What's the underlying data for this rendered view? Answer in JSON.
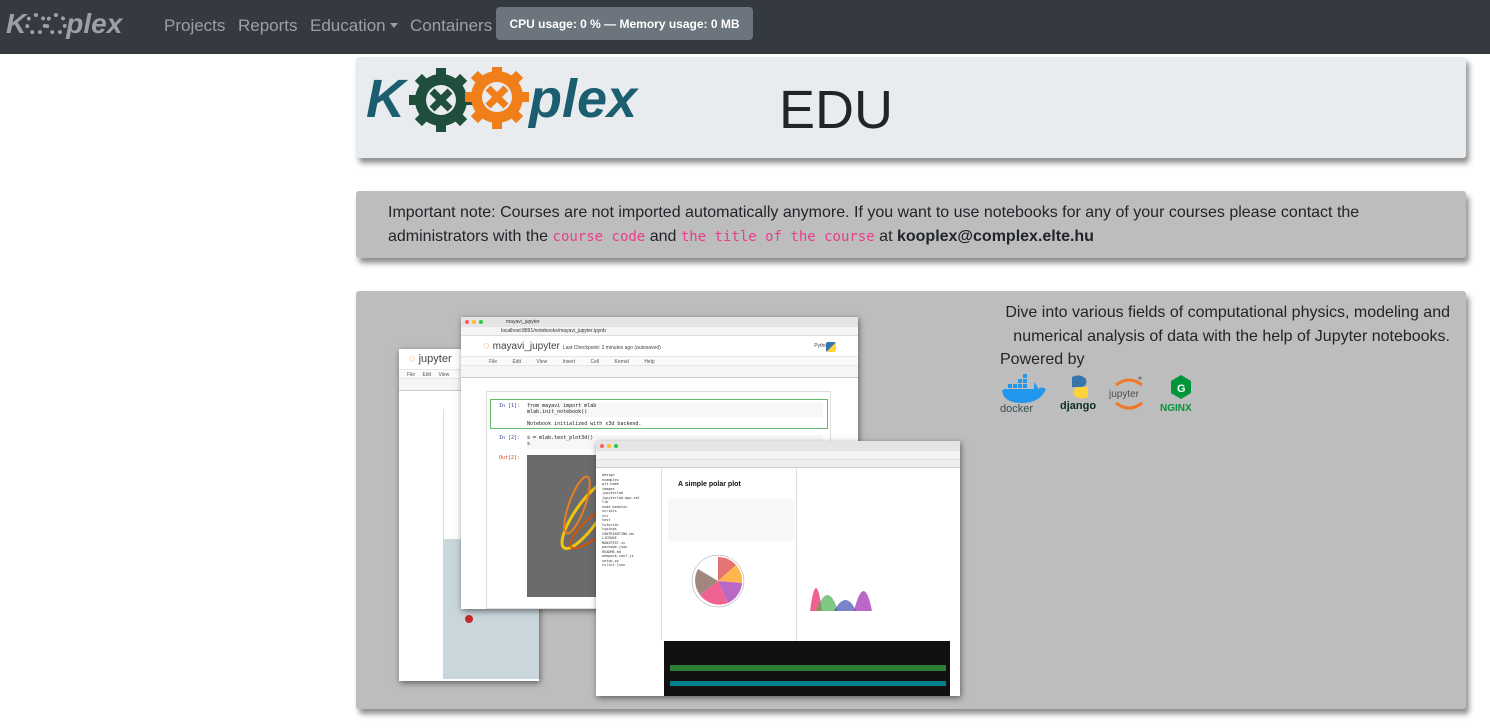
{
  "navbar": {
    "brand": "K plex",
    "links": [
      "Projects",
      "Reports",
      "Education",
      "Containers"
    ],
    "usage": "CPU usage: 0 % — Memory usage: 0 MB"
  },
  "header_card": {
    "logo_text": "K plex",
    "title": "EDU"
  },
  "note": {
    "prefix": "Important note: Courses are not imported automatically anymore. If you want to use notebooks for any of your courses please contact the administrators with the",
    "code1": "course code",
    "mid": "and",
    "code2": "the title of the course",
    "at": "at",
    "email": "kooplex@complex.elte.hu"
  },
  "main": {
    "description": "Dive into various fields of computational physics, modeling and numerical analysis of data with the help of Jupyter notebooks.",
    "powered_by": "Powered by",
    "logos": [
      "docker",
      "django",
      "jupyter",
      "NGINX"
    ]
  },
  "screenshot": {
    "notebook_title": "mayavi_jupyter",
    "checkpoint": "Last Checkpoint: 2 minutes ago (autosaved)",
    "url": "localhost:8891/notebooks/mayavi_jupyter.ipynb",
    "kernel": "Python 2",
    "menu": "File Edit View Insert Cell Kernel Help",
    "back_logo": "jupyter",
    "cell1_prompt": "In [1]:",
    "cell1_code": "from mayavi import mlab\nmlab.init_notebook()",
    "cell1_out": "Notebook initialized with x3d backend.",
    "cell2_prompt": "In [2]:",
    "cell2_code": "s = mlab.test_plot3d()\ns",
    "out2_prompt": "Out[2]:",
    "lab_title": "A simple polar plot"
  }
}
